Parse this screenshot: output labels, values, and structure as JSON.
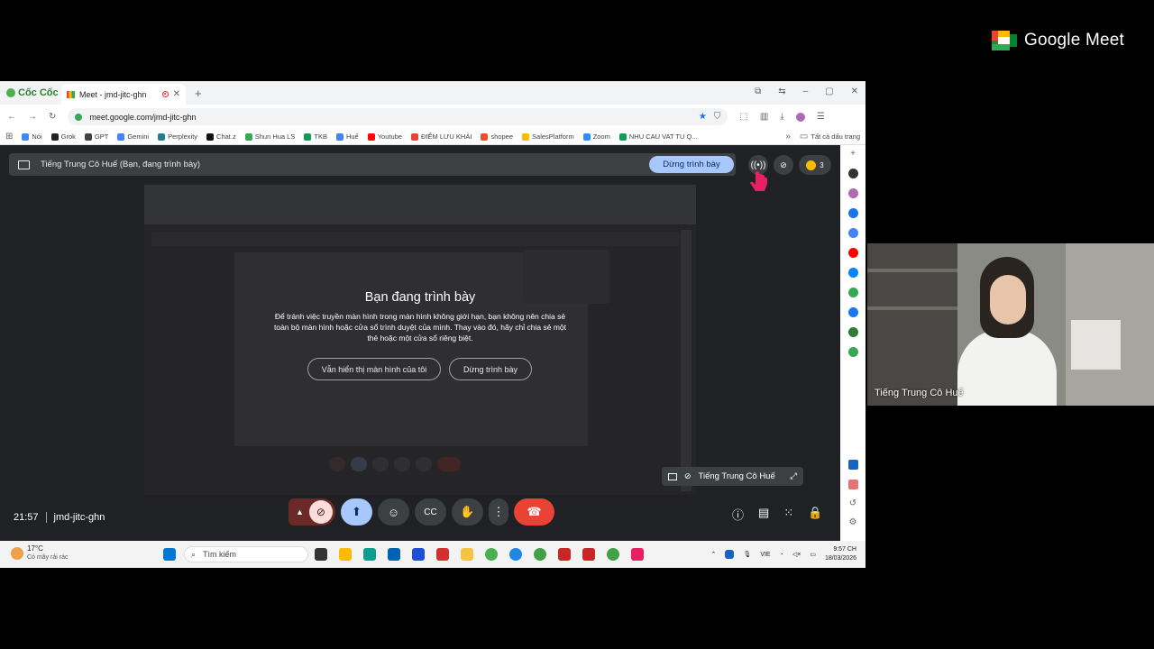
{
  "logo": {
    "text": "Google Meet"
  },
  "browser": {
    "brand": "Cốc Cốc",
    "tab_title": "Meet - jmd-jitc-ghn",
    "new_tab": "+",
    "url": "meet.google.com/jmd-jitc-ghn",
    "bookmarks": [
      {
        "label": "Nói",
        "color": "#4285f4"
      },
      {
        "label": "Grok",
        "color": "#222222"
      },
      {
        "label": "GPT",
        "color": "#444444"
      },
      {
        "label": "Gemini",
        "color": "#4285f4"
      },
      {
        "label": "Perplexity",
        "color": "#20808d"
      },
      {
        "label": "Chat.z",
        "color": "#111111"
      },
      {
        "label": "Shun Hua LS",
        "color": "#34a853"
      },
      {
        "label": "TKB",
        "color": "#0f9d58"
      },
      {
        "label": "Huế",
        "color": "#4285f4"
      },
      {
        "label": "Youtube",
        "color": "#ff0000"
      },
      {
        "label": "ĐIỂM LƯU KHẢI",
        "color": "#ea4335"
      },
      {
        "label": "shopee",
        "color": "#ee4d2d"
      },
      {
        "label": "SalesPlatform",
        "color": "#fbbc04"
      },
      {
        "label": "Zoom",
        "color": "#2d8cff"
      },
      {
        "label": "NHU CAU VAT TU Q...",
        "color": "#0f9d58"
      }
    ],
    "all_bookmarks": "Tất cả dấu trang"
  },
  "meet": {
    "banner_text": "Tiếng Trung Cô Huế (Bạn, đang trình bày)",
    "stop_presenting_top": "Dừng trình bày",
    "participant_count": "3",
    "dialog": {
      "title": "Bạn đang trình bày",
      "body": "Để tránh việc truyền màn hình trong màn hình không giới hạn, bạn không nên chia sẻ toàn bộ màn hình hoặc cửa sổ trình duyệt của mình. Thay vào đó, hãy chỉ chia sẻ một thẻ hoặc một cửa sổ riêng biệt.",
      "keep_showing": "Vẫn hiển thị màn hình của tôi",
      "stop": "Dừng trình bày"
    },
    "tile_label": "Tiếng Trung Cô Huế",
    "time": "21:57",
    "meeting_code": "jmd-jitc-ghn"
  },
  "taskbar": {
    "temperature": "17°C",
    "weather": "Có mây rải rác",
    "search_placeholder": "Tìm kiếm",
    "lang": "VIE",
    "time": "9:57 CH",
    "date": "18/03/2026"
  },
  "webcam": {
    "name": "Tiếng Trung Cô Huế"
  },
  "colors": {
    "accent": "#a8c7fa",
    "end_call": "#ea4335",
    "meet_bg": "#202124"
  }
}
